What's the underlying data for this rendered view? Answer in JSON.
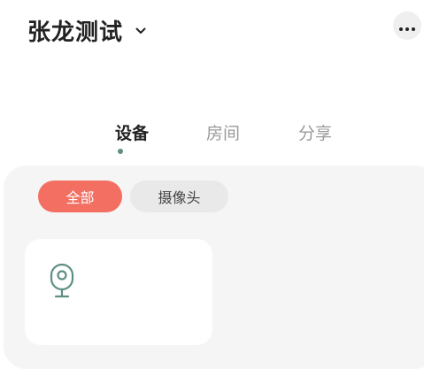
{
  "header": {
    "home_name": "张龙测试",
    "switch_icon": "chevron-down-icon",
    "more_icon": "more-icon"
  },
  "tabs": [
    {
      "label": "设备",
      "active": true
    },
    {
      "label": "房间",
      "active": false
    },
    {
      "label": "分享",
      "active": false
    }
  ],
  "filters": [
    {
      "label": "全部",
      "selected": true
    },
    {
      "label": "摄像头",
      "selected": false
    }
  ],
  "devices": [
    {
      "icon": "camera-icon"
    }
  ],
  "colors": {
    "accent": "#f26f62",
    "tab_indicator": "#5e8f83",
    "device_icon": "#5e8f83",
    "panel_background": "#f5f5f5"
  }
}
